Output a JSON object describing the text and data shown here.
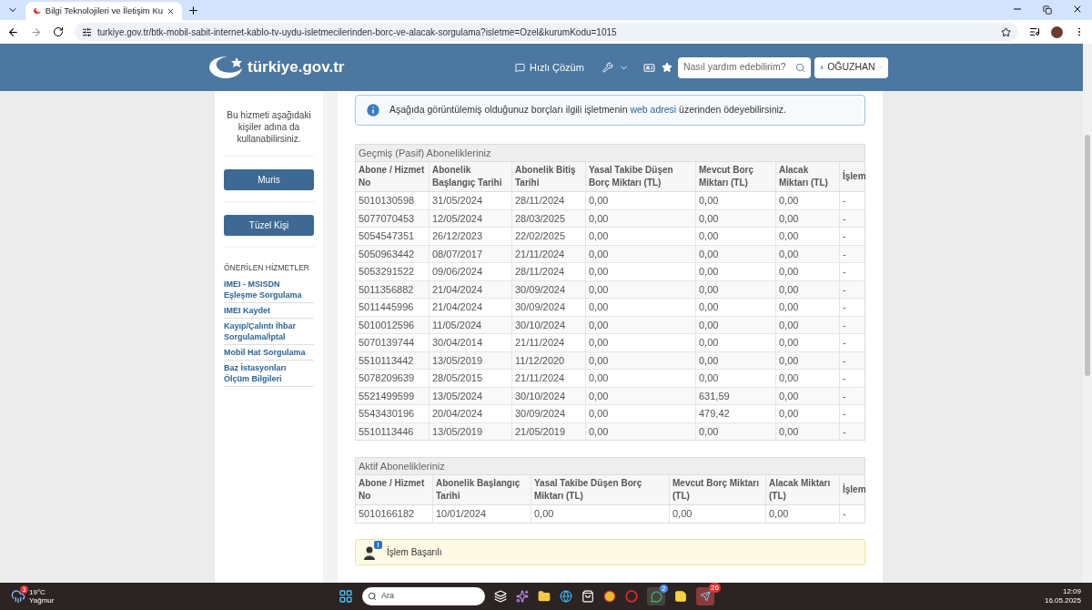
{
  "browser": {
    "tab_title": "Bilgi Teknolojileri ve İletişim Ku",
    "url": "turkiye.gov.tr/btk-mobil-sabit-internet-kablo-tv-uydu-isletmecilerinden-borc-ve-alacak-sorgulama?isletme=Ozel&kurumKodu=1015"
  },
  "header": {
    "logo": "türkiye.gov.tr",
    "quick_solution": "Hızlı Çözüm",
    "search_placeholder": "Nasıl yardım edebilirim?",
    "user": "OĞUZHAN"
  },
  "sidebar": {
    "intro": "Bu hizmeti aşağıdaki kişiler adına da kullanabilirsiniz.",
    "buttons": [
      "Muris",
      "Tüzel Kişi"
    ],
    "recommended_title": "ÖNERİLEN HİZMETLER",
    "links": [
      "IMEI - MSISDN Eşleşme Sorgulama",
      "IMEI Kaydet",
      "Kayıp/Çalıntı İhbar Sorgulama/İptal",
      "Mobil Hat Sorgulama",
      "Baz İstasyonları Ölçüm Bilgileri"
    ]
  },
  "info": {
    "before": "Aşağıda görüntülemiş olduğunuz borçları ilgili işletmenin ",
    "link": "web adresi",
    "after": " üzerinden ödeyebilirsiniz."
  },
  "past_table": {
    "title": "Geçmiş (Pasif) Abonelikleriniz",
    "columns": [
      "Abone / Hizmet No",
      "Abonelik Başlangıç Tarihi",
      "Abonelik Bitiş Tarihi",
      "Yasal Takibe Düşen Borç Miktarı (TL)",
      "Mevcut Borç Miktarı (TL)",
      "Alacak Miktarı (TL)",
      "İşlem"
    ],
    "rows": [
      [
        "5010130598",
        "31/05/2024",
        "28/11/2024",
        "0,00",
        "0,00",
        "0,00",
        "-"
      ],
      [
        "5077070453",
        "12/05/2024",
        "28/03/2025",
        "0,00",
        "0,00",
        "0,00",
        "-"
      ],
      [
        "5054547351",
        "26/12/2023",
        "22/02/2025",
        "0,00",
        "0,00",
        "0,00",
        "-"
      ],
      [
        "5050963442",
        "08/07/2017",
        "21/11/2024",
        "0,00",
        "0,00",
        "0,00",
        "-"
      ],
      [
        "5053291522",
        "09/06/2024",
        "28/11/2024",
        "0,00",
        "0,00",
        "0,00",
        "-"
      ],
      [
        "5011356882",
        "21/04/2024",
        "30/09/2024",
        "0,00",
        "0,00",
        "0,00",
        "-"
      ],
      [
        "5011445996",
        "21/04/2024",
        "30/09/2024",
        "0,00",
        "0,00",
        "0,00",
        "-"
      ],
      [
        "5010012596",
        "11/05/2024",
        "30/10/2024",
        "0,00",
        "0,00",
        "0,00",
        "-"
      ],
      [
        "5070139744",
        "30/04/2014",
        "21/11/2024",
        "0,00",
        "0,00",
        "0,00",
        "-"
      ],
      [
        "5510113442",
        "13/05/2019",
        "11/12/2020",
        "0,00",
        "0,00",
        "0,00",
        "-"
      ],
      [
        "5078209639",
        "28/05/2015",
        "21/11/2024",
        "0,00",
        "0,00",
        "0,00",
        "-"
      ],
      [
        "5521499599",
        "13/05/2024",
        "30/10/2024",
        "0,00",
        "631,59",
        "0,00",
        "-"
      ],
      [
        "5543430196",
        "20/04/2024",
        "30/09/2024",
        "0,00",
        "479,42",
        "0,00",
        "-"
      ],
      [
        "5510113446",
        "13/05/2019",
        "21/05/2019",
        "0,00",
        "0,00",
        "0,00",
        "-"
      ]
    ]
  },
  "active_table": {
    "title": "Aktif Abonelikleriniz",
    "columns": [
      "Abone / Hizmet No",
      "Abonelik Başlangıç Tarihi",
      "Yasal Takibe Düşen Borç Miktarı (TL)",
      "Mevcut Borç Miktarı (TL)",
      "Alacak Miktarı (TL)",
      "İşlem"
    ],
    "rows": [
      [
        "5010166182",
        "10/01/2024",
        "0,00",
        "0,00",
        "0,00",
        "-"
      ]
    ]
  },
  "alert": {
    "badge": "!",
    "text": "İşlem Başarılı"
  },
  "taskbar": {
    "weather_badge": "3",
    "temperature": "19°C",
    "condition": "Yağmur",
    "search_placeholder": "Ara",
    "whatsapp_badge": "2",
    "telegram_badge": "26",
    "time": "12:09",
    "date": "16.05.2025"
  }
}
